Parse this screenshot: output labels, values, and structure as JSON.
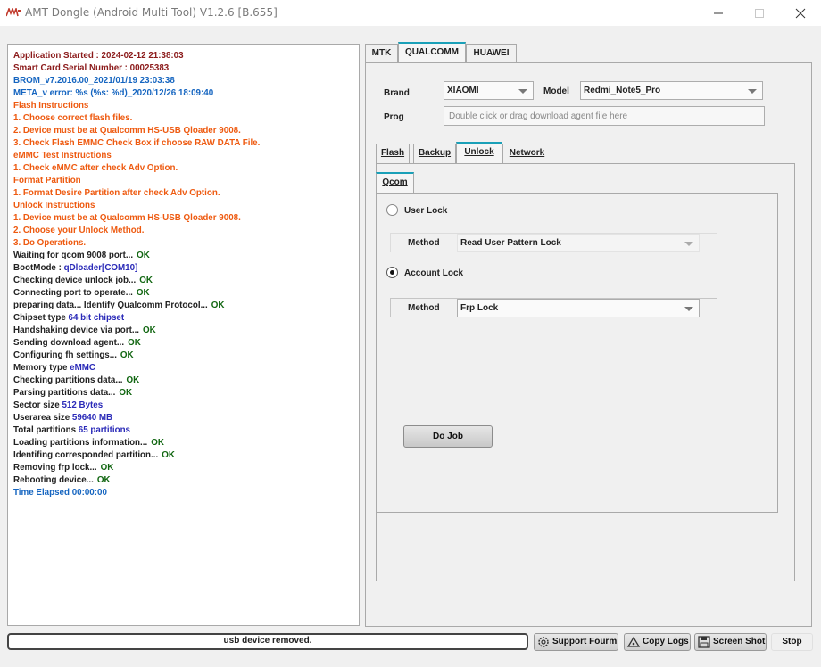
{
  "window": {
    "title": "AMT Dongle (Android Multi Tool) V1.2.6 [B.655]",
    "minimize_icon": "minimize-icon",
    "maximize_icon": "maximize-icon",
    "close_icon": "close-icon"
  },
  "log": {
    "lines": [
      {
        "text": "Application Started : 2024-02-12 21:38:03",
        "ok": "",
        "color": "#8b1a1a"
      },
      {
        "text": "Smart Card Serial Number : 00025383",
        "ok": "",
        "color": "#8b1a1a"
      },
      {
        "text": "BROM_v7.2016.00_2021/01/19 23:03:38",
        "ok": "",
        "color": "#1565c0"
      },
      {
        "text": "META_v error: %s (%s: %d)_2020/12/26 18:09:40",
        "ok": "",
        "color": "#1565c0"
      },
      {
        "text": "Flash Instructions",
        "ok": "",
        "color": "#ee5a10"
      },
      {
        "text": "1. Choose correct flash files.",
        "ok": "",
        "color": "#ee5a10"
      },
      {
        "text": "2. Device must be at Qualcomm HS-USB Qloader 9008.",
        "ok": "",
        "color": "#ee5a10"
      },
      {
        "text": "3. Check Flash EMMC Check Box if choose RAW DATA File.",
        "ok": "",
        "color": "#ee5a10"
      },
      {
        "text": "eMMC Test Instructions",
        "ok": "",
        "color": "#ee5a10"
      },
      {
        "text": "1. Check eMMC after check Adv Option.",
        "ok": "",
        "color": "#ee5a10"
      },
      {
        "text": "Format Partition",
        "ok": "",
        "color": "#ee5a10"
      },
      {
        "text": "1. Format Desire Partition after check Adv Option.",
        "ok": "",
        "color": "#ee5a10"
      },
      {
        "text": "Unlock Instructions",
        "ok": "",
        "color": "#ee5a10"
      },
      {
        "text": "1. Device must be at Qualcomm HS-USB Qloader 9008.",
        "ok": "",
        "color": "#ee5a10"
      },
      {
        "text": "2. Choose your Unlock Method.",
        "ok": "",
        "color": "#ee5a10"
      },
      {
        "text": "3. Do Operations.",
        "ok": "",
        "color": "#ee5a10"
      },
      {
        "text": "Waiting for qcom 9008 port...",
        "ok": "OK",
        "color": "#222"
      },
      {
        "text": "BootMode : ",
        "ok": "qDloader[COM10]",
        "color": "#222",
        "okcolor": "#2a2ab8"
      },
      {
        "text": "Checking device unlock job...",
        "ok": "OK",
        "color": "#222"
      },
      {
        "text": "Connecting port to operate...",
        "ok": "OK",
        "color": "#222"
      },
      {
        "text": "preparing data... Identify Qualcomm Protocol...",
        "ok": "OK",
        "color": "#222"
      },
      {
        "text": "Chipset type ",
        "ok": "64 bit chipset",
        "color": "#222",
        "okcolor": "#2a2ab8"
      },
      {
        "text": "Handshaking device via port...",
        "ok": "OK",
        "color": "#222"
      },
      {
        "text": "Sending download agent...",
        "ok": "OK",
        "color": "#222"
      },
      {
        "text": "Configuring fh settings...",
        "ok": "OK",
        "color": "#222"
      },
      {
        "text": "Memory type ",
        "ok": "eMMC",
        "color": "#222",
        "okcolor": "#2a2ab8"
      },
      {
        "text": "Checking partitions data...",
        "ok": "OK",
        "color": "#222"
      },
      {
        "text": "Parsing partitions data...",
        "ok": "OK",
        "color": "#222"
      },
      {
        "text": "Sector size ",
        "ok": "512 Bytes",
        "color": "#222",
        "okcolor": "#2a2ab8"
      },
      {
        "text": "Userarea size ",
        "ok": "59640 MB",
        "color": "#222",
        "okcolor": "#2a2ab8"
      },
      {
        "text": "Total partitions ",
        "ok": "65 partitions",
        "color": "#222",
        "okcolor": "#2a2ab8"
      },
      {
        "text": "Loading partitions information...",
        "ok": "OK",
        "color": "#222"
      },
      {
        "text": "Identifing corresponded partition...",
        "ok": "OK",
        "color": "#222"
      },
      {
        "text": "Removing frp lock...",
        "ok": "OK",
        "color": "#222"
      },
      {
        "text": "Rebooting device...",
        "ok": "OK",
        "color": "#222"
      },
      {
        "text": "Time Elapsed      00:00:00",
        "ok": "",
        "color": "#1565c0"
      }
    ]
  },
  "tabs": {
    "mtk": "MTK",
    "qualcomm": "QUALCOMM",
    "huawei": "HUAWEI"
  },
  "device": {
    "brand_label": "Brand",
    "brand_value": "XIAOMI",
    "model_label": "Model",
    "model_value": "Redmi_Note5_Pro",
    "prog_label": "Prog",
    "prog_placeholder": "Double click or drag download agent file here"
  },
  "subtabs": {
    "flash": "Flash",
    "backup": "Backup",
    "unlock": "Unlock",
    "network": "Network"
  },
  "unlock": {
    "qcom_tab": "Qcom",
    "user_lock_label": "User Lock",
    "user_method_label": "Method",
    "user_method_value": "Read User Pattern Lock",
    "account_lock_label": "Account Lock",
    "account_method_label": "Method",
    "account_method_value": "Frp Lock",
    "do_job_label": "Do Job",
    "selected": "account_lock"
  },
  "statusbar": {
    "message": "usb device removed.",
    "support_label": "Support Fourm",
    "copy_logs_label": "Copy Logs",
    "screenshot_label": "Screen Shot",
    "stop_label": "Stop"
  }
}
